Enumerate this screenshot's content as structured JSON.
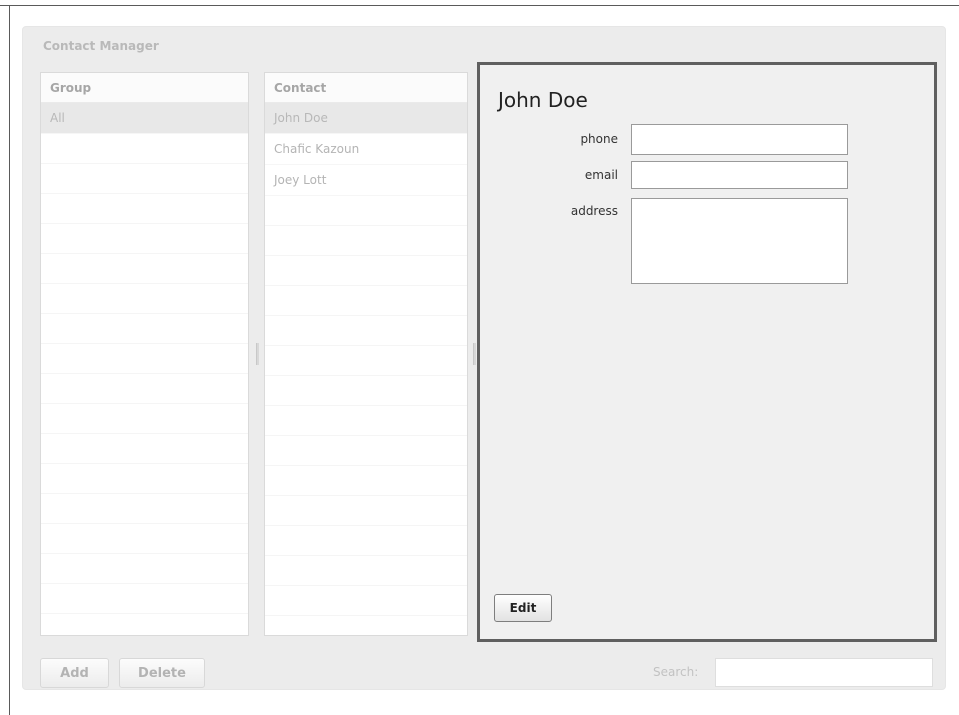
{
  "app": {
    "title": "Contact Manager"
  },
  "groups": {
    "header": "Group",
    "items": [
      {
        "label": "All",
        "selected": true
      }
    ]
  },
  "contacts": {
    "header": "Contact",
    "items": [
      {
        "label": "John Doe",
        "selected": true
      },
      {
        "label": "Chafic Kazoun",
        "selected": false
      },
      {
        "label": "Joey Lott",
        "selected": false
      }
    ]
  },
  "detail": {
    "name": "John Doe",
    "fields": {
      "phone_label": "phone",
      "phone_value": "",
      "email_label": "email",
      "email_value": "",
      "address_label": "address",
      "address_value": ""
    },
    "edit_label": "Edit"
  },
  "footer": {
    "add_label": "Add",
    "delete_label": "Delete",
    "search_label": "Search:",
    "search_value": ""
  },
  "colors": {
    "detail_border": "#5f5f5f",
    "panel_bg": "#ececec",
    "selected_row": "#e8e8e8"
  }
}
